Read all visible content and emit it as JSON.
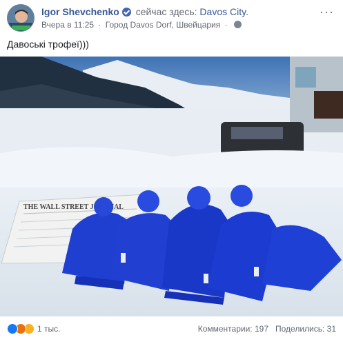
{
  "post": {
    "author_name": "Igor Shevchenko",
    "here_text": "сейчас здесь:",
    "place": "Davos City.",
    "time": "Вчера в 11:25",
    "location": "Город Davos Dorf, Швейцария",
    "separator": "·",
    "more_label": "···",
    "text": "Давоські трофеї)))"
  },
  "photo": {
    "newspaper_title": "THE WALL STREET JOURNAL"
  },
  "footer": {
    "reaction_count": "1 тыс.",
    "comments": "Комментарии: 197",
    "shares": "Поделились: 31"
  },
  "colors": {
    "link": "#385898",
    "verified": "#4267b2",
    "beanie": "#1f3fd1"
  },
  "icons": {
    "verified": "verified-badge-icon",
    "globe": "globe-icon",
    "like": "like-reaction-icon",
    "angry": "angry-reaction-icon",
    "haha": "haha-reaction-icon"
  }
}
